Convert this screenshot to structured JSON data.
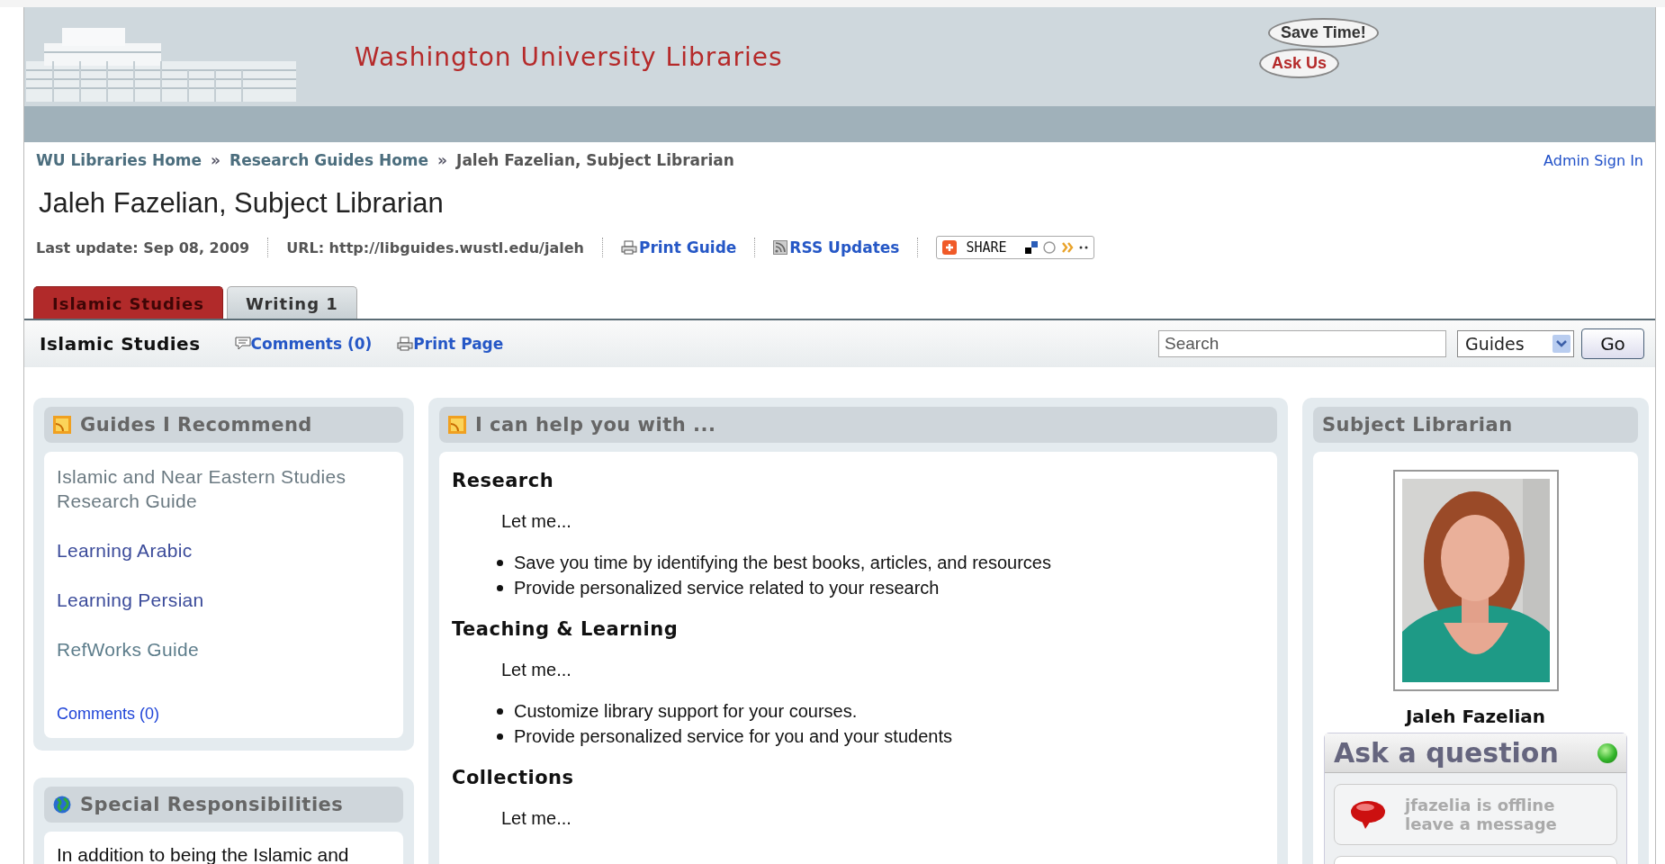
{
  "header": {
    "title": "Washington University Libraries",
    "bubbles": [
      "Save Time!",
      "Ask Us"
    ]
  },
  "breadcrumb": [
    {
      "label": "WU Libraries Home",
      "kind": "link"
    },
    {
      "label": "»",
      "kind": "sep"
    },
    {
      "label": "Research Guides Home",
      "kind": "link"
    },
    {
      "label": "»",
      "kind": "sep"
    },
    {
      "label": "Jaleh Fazelian, Subject Librarian",
      "kind": "current"
    }
  ],
  "admin_link": "Admin Sign In",
  "page_title": "Jaleh Fazelian, Subject Librarian",
  "meta": {
    "last_update": "Last update: Sep 08, 2009",
    "url": "URL: http://libguides.wustl.edu/jaleh",
    "print_guide": "Print Guide",
    "rss": "RSS Updates",
    "share": "SHARE"
  },
  "tabs": [
    {
      "label": "Islamic Studies",
      "selected": true
    },
    {
      "label": "Writing 1",
      "selected": false
    }
  ],
  "subbar": {
    "title": "Islamic Studies",
    "comments": "Comments (0)",
    "print_page": "Print Page",
    "search": {
      "placeholder": "Search"
    },
    "scope": "Guides",
    "go": "Go"
  },
  "left_boxes": [
    {
      "title": "Guides I Recommend",
      "links": [
        {
          "label": "Islamic and Near Eastern Studies Research Guide",
          "color": "#6b7a82"
        },
        {
          "label": "Learning Arabic",
          "color": "#3b4b9a"
        },
        {
          "label": "Learning Persian",
          "color": "#3b4b9a"
        },
        {
          "label": "RefWorks Guide",
          "color": "#5d7d8b"
        }
      ],
      "comments": "Comments (0)"
    },
    {
      "title": "Special Responsibilities",
      "text": "In addition to being the Islamic and"
    }
  ],
  "middle_box": {
    "title": "I can help you with ...",
    "sections": [
      {
        "heading": "Research",
        "intro": "Let me...",
        "bullets": [
          "Save you time by identifying the best books, articles, and resources",
          "Provide personalized service related to your research"
        ]
      },
      {
        "heading": "Teaching & Learning",
        "intro": "Let me...",
        "bullets": [
          "Customize library support for your courses.",
          "Provide personalized service for you and your students"
        ]
      },
      {
        "heading": "Collections",
        "intro": "Let me..."
      }
    ]
  },
  "right_box": {
    "title": "Subject Librarian",
    "name": "Jaleh Fazelian",
    "ask": {
      "title": "Ask a question",
      "status_lines": [
        "jfazelia is offline",
        "leave a message"
      ]
    }
  }
}
